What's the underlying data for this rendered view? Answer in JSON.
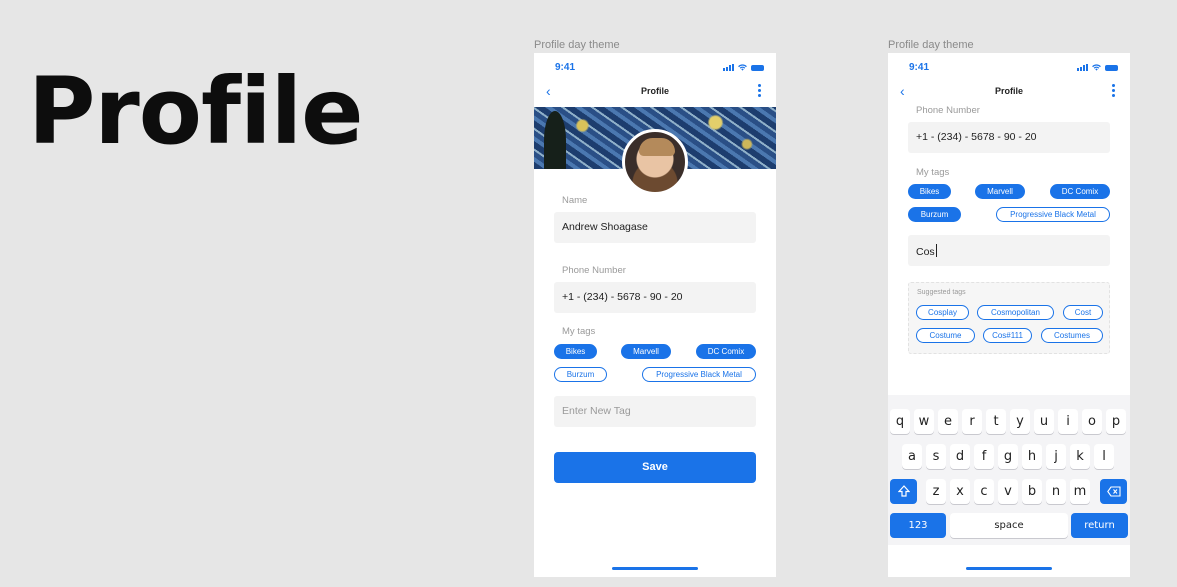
{
  "page_title": "Profile",
  "frames": [
    {
      "label": "Profile day theme",
      "status_time": "9:41",
      "nav_title": "Profile",
      "name_label": "Name",
      "name_value": "Andrew Shoagase",
      "phone_label": "Phone Number",
      "phone_value": "+1 - (234) - 5678 - 90 - 20",
      "tags_label": "My tags",
      "tags": [
        "Bikes",
        "Marvell",
        "DC Comix",
        "Burzum",
        "Progressive Black Metal"
      ],
      "new_tag_placeholder": "Enter New Tag",
      "save_label": "Save"
    },
    {
      "label": "Profile day theme",
      "status_time": "9:41",
      "nav_title": "Profile",
      "phone_label": "Phone Number",
      "phone_value": "+1 - (234) - 5678 - 90 - 20",
      "tags_label": "My tags",
      "tags": [
        "Bikes",
        "Marvell",
        "DC Comix",
        "Burzum",
        "Progressive Black Metal"
      ],
      "tag_input_value": "Cos",
      "suggested_label": "Suggested tags",
      "suggested": [
        "Cosplay",
        "Cosmopolitan",
        "Cost",
        "Costume",
        "Cos#111",
        "Costumes"
      ],
      "keyboard": {
        "row1": [
          "q",
          "w",
          "e",
          "r",
          "t",
          "y",
          "u",
          "i",
          "o",
          "p"
        ],
        "row2": [
          "a",
          "s",
          "d",
          "f",
          "g",
          "h",
          "j",
          "k",
          "l"
        ],
        "row3": [
          "z",
          "x",
          "c",
          "v",
          "b",
          "n",
          "m"
        ],
        "numbers": "123",
        "space": "space",
        "return": "return"
      }
    }
  ],
  "colors": {
    "accent": "#1a73e8",
    "background": "#e6e6e6"
  },
  "icons": [
    "back-chevron-icon",
    "more-vertical-icon",
    "signal-icon",
    "wifi-icon",
    "battery-icon",
    "shift-icon",
    "backspace-icon"
  ]
}
